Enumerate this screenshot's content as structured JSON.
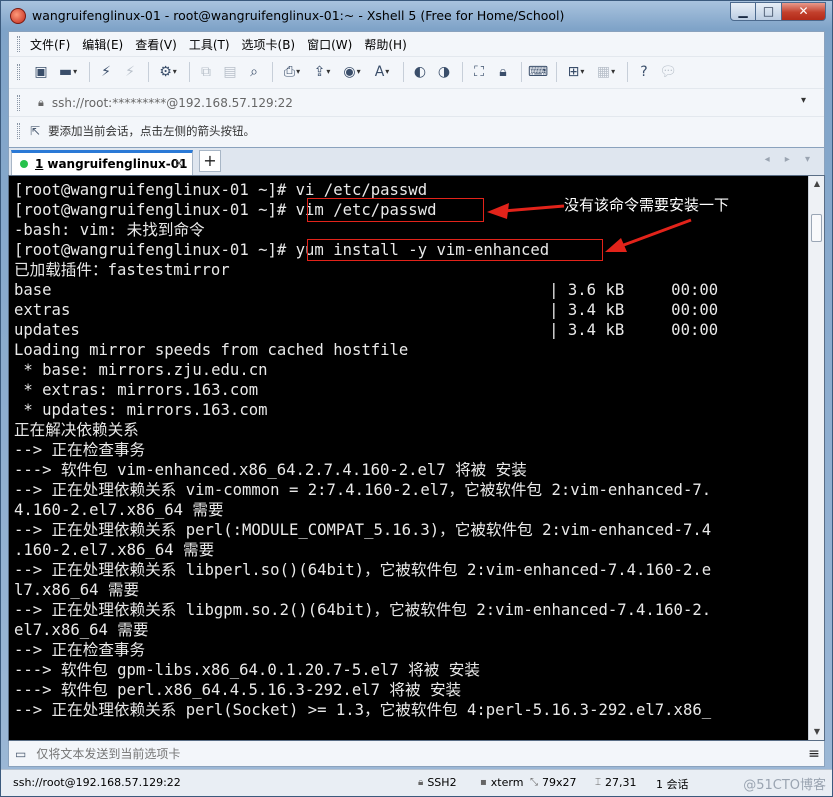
{
  "window": {
    "title": "wangruifenglinux-01 - root@wangruifenglinux-01:~ - Xshell 5 (Free for Home/School)",
    "minimize_glyph": "▁",
    "maximize_glyph": "□",
    "close_glyph": "✕"
  },
  "menu": [
    "文件(F)",
    "编辑(E)",
    "查看(V)",
    "工具(T)",
    "选项卡(B)",
    "窗口(W)",
    "帮助(H)"
  ],
  "address": {
    "value": "ssh://root:*********@192.168.57.129:22",
    "dropdown_glyph": "▾"
  },
  "hint": {
    "text": "要添加当前会话，点击左侧的箭头按钮。"
  },
  "tab": {
    "number": "1",
    "label": "wangruifenglinux-01",
    "close_glyph": "×",
    "add_glyph": "+",
    "nav_glyphs": "◂ ▸ ▾"
  },
  "terminal": {
    "lines": [
      "[root@wangruifenglinux-01 ~]# vi /etc/passwd",
      "[root@wangruifenglinux-01 ~]# vim /etc/passwd",
      "-bash: vim: 未找到命令",
      "[root@wangruifenglinux-01 ~]# yum install -y vim-enhanced",
      "已加载插件：fastestmirror",
      "base                                                     | 3.6 kB     00:00",
      "extras                                                   | 3.4 kB     00:00",
      "updates                                                  | 3.4 kB     00:00",
      "Loading mirror speeds from cached hostfile",
      " * base: mirrors.zju.edu.cn",
      " * extras: mirrors.163.com",
      " * updates: mirrors.163.com",
      "正在解决依赖关系",
      "--> 正在检查事务",
      "---> 软件包 vim-enhanced.x86_64.2.7.4.160-2.el7 将被 安装",
      "--> 正在处理依赖关系 vim-common = 2:7.4.160-2.el7，它被软件包 2:vim-enhanced-7.",
      "4.160-2.el7.x86_64 需要",
      "--> 正在处理依赖关系 perl(:MODULE_COMPAT_5.16.3)，它被软件包 2:vim-enhanced-7.4",
      ".160-2.el7.x86_64 需要",
      "--> 正在处理依赖关系 libperl.so()(64bit)，它被软件包 2:vim-enhanced-7.4.160-2.e",
      "l7.x86_64 需要",
      "--> 正在处理依赖关系 libgpm.so.2()(64bit)，它被软件包 2:vim-enhanced-7.4.160-2.",
      "el7.x86_64 需要",
      "--> 正在检查事务",
      "---> 软件包 gpm-libs.x86_64.0.1.20.7-5.el7 将被 安装",
      "---> 软件包 perl.x86_64.4.5.16.3-292.el7 将被 安装",
      "--> 正在处理依赖关系 perl(Socket) >= 1.3，它被软件包 4:perl-5.16.3-292.el7.x86_"
    ],
    "annotation": "没有该命令需要安装一下",
    "highlight_color": "#e2231a"
  },
  "sendbar": {
    "placeholder": "仅将文本发送到当前选项卡",
    "menu_glyph": "≡"
  },
  "status": {
    "connection": "ssh://root@192.168.57.129:22",
    "protocol": "SSH2",
    "terminal_type": "xterm",
    "size": "79x27",
    "cursor": "27,31",
    "sessions": "1 会话",
    "watermark": "@51CTO博客"
  }
}
